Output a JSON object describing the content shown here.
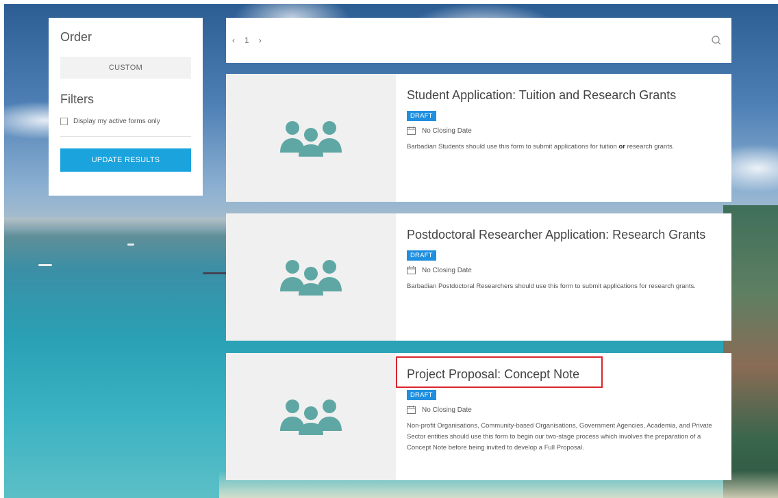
{
  "sidebar": {
    "order_title": "Order",
    "order_value": "CUSTOM",
    "filters_title": "Filters",
    "active_forms_label": "Display my active forms only",
    "active_forms_checked": false,
    "update_label": "UPDATE RESULTS"
  },
  "topbar": {
    "prev": "‹",
    "page": "1",
    "next": "›",
    "search_icon": "search-icon"
  },
  "cards": [
    {
      "title": "Student Application: Tuition and Research Grants",
      "badge": "DRAFT",
      "closing": "No Closing Date",
      "desc_pre": "Barbadian Students should use this form to submit applications for tuition ",
      "desc_bold": "or",
      "desc_post": " research grants."
    },
    {
      "title": "Postdoctoral Researcher Application: Research Grants",
      "badge": "DRAFT",
      "closing": "No Closing Date",
      "desc": "Barbadian Postdoctoral Researchers should use this form to submit applications for research grants."
    },
    {
      "title": "Project Proposal: Concept Note",
      "badge": "DRAFT",
      "closing": "No Closing Date",
      "desc": "Non-profit Organisations, Community-based Organisations, Government Agencies, Academia, and Private Sector entities should use this form to begin our two-stage process which involves the preparation of a Concept Note before being invited to develop a Full Proposal."
    }
  ],
  "colors": {
    "accent_button": "#1aa3dd",
    "badge": "#1f8fe0",
    "icon": "#5fa7a4",
    "highlight": "#d9252b"
  }
}
